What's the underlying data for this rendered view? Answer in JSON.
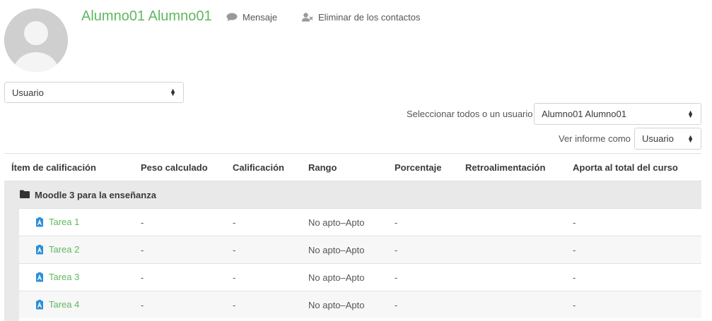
{
  "profile": {
    "name": "Alumno01 Alumno01",
    "message_label": "Mensaje",
    "remove_contact_label": "Eliminar de los contactos"
  },
  "report_select": {
    "value": "Usuario"
  },
  "select_user": {
    "label": "Seleccionar todos o un usuario",
    "value": "Alumno01 Alumno01"
  },
  "view_as": {
    "label": "Ver informe como",
    "value": "Usuario"
  },
  "table": {
    "headers": [
      "Ítem de calificación",
      "Peso calculado",
      "Calificación",
      "Rango",
      "Porcentaje",
      "Retroalimentación",
      "Aporta al total del curso"
    ],
    "category": "Moodle 3 para la enseñanza",
    "rows": [
      {
        "item": "Tarea 1",
        "weight": "-",
        "grade": "-",
        "range": "No apto–Apto",
        "percent": "-",
        "feedback": "",
        "contrib": "-"
      },
      {
        "item": "Tarea 2",
        "weight": "-",
        "grade": "-",
        "range": "No apto–Apto",
        "percent": "-",
        "feedback": "",
        "contrib": "-"
      },
      {
        "item": "Tarea 3",
        "weight": "-",
        "grade": "-",
        "range": "No apto–Apto",
        "percent": "-",
        "feedback": "",
        "contrib": "-"
      },
      {
        "item": "Tarea 4",
        "weight": "-",
        "grade": "-",
        "range": "No apto–Apto",
        "percent": "-",
        "feedback": "",
        "contrib": "-"
      }
    ]
  },
  "colors": {
    "accent": "#5fb85f",
    "assign_icon": "#2a8fd8"
  }
}
